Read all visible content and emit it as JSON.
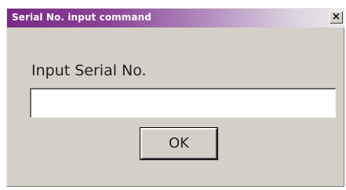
{
  "window": {
    "title": "Serial No. input command",
    "close_icon": "close-icon",
    "close_glyph": "×",
    "colors": {
      "titlebar_start": "#7a2a86",
      "titlebar_end": "#ece8ec",
      "dialog_bg": "#d4d0c8"
    }
  },
  "prompt": {
    "label": "Input Serial No."
  },
  "serial_input": {
    "value": "",
    "placeholder": ""
  },
  "buttons": {
    "ok_label": "OK"
  }
}
